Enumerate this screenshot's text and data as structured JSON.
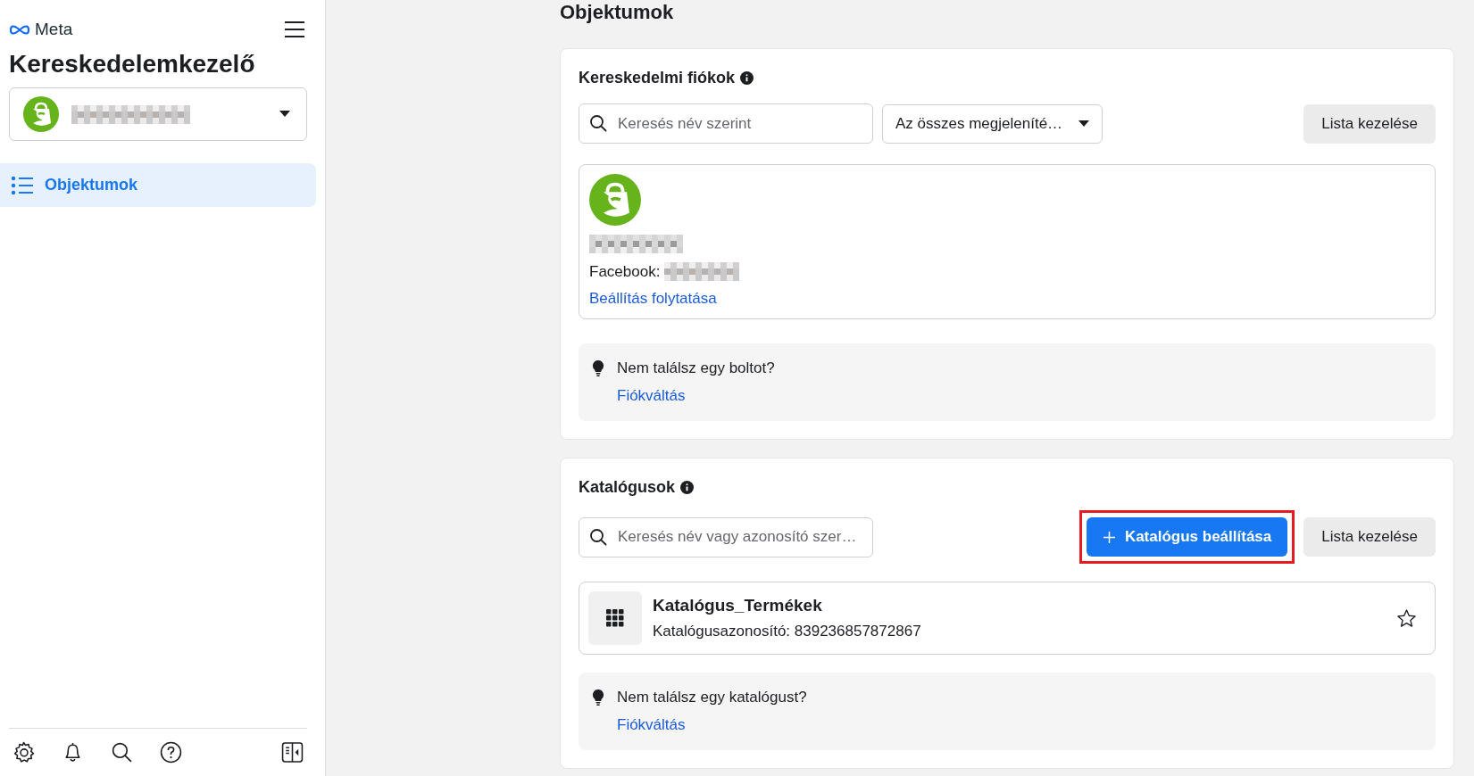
{
  "sidebar": {
    "brand": "Meta",
    "title": "Kereskedelemkezelő",
    "nav_items": [
      {
        "label": "Objektumok",
        "selected": true
      }
    ]
  },
  "page_title": "Objektumok",
  "commerce_accounts": {
    "title": "Kereskedelmi fiókok",
    "search": {
      "placeholder": "Keresés név szerint"
    },
    "filter": "Az összes megjeleníté…",
    "manage_button": "Lista kezelése",
    "shop": {
      "facebook_label": "Facebook:",
      "link": "Beállítás folytatása"
    },
    "tip": {
      "text": "Nem találsz egy boltot?",
      "link": "Fiókváltás"
    }
  },
  "catalogs": {
    "title": "Katalógusok",
    "search": {
      "placeholder": "Keresés név vagy azonosító szer…"
    },
    "setup_button": {
      "label": "Katalógus beállítása",
      "highlighted": true
    },
    "manage_button": "Lista kezelése",
    "items": [
      {
        "name": "Katalógus_Termékek",
        "id_text": "Katalógusazonosító: 839236857872867",
        "starred": false
      }
    ],
    "tip": {
      "text": "Nem találsz egy katalógust?",
      "link": "Fiókváltás"
    }
  }
}
